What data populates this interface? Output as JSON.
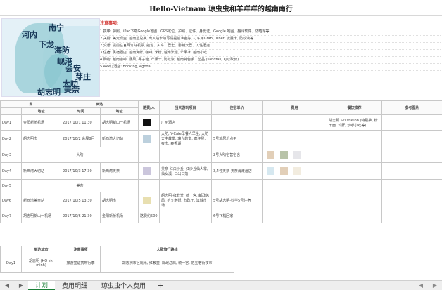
{
  "title": "Hello-Vietnam 琼虫虫和羊咩咩的越南南行",
  "map": {
    "cities": [
      "南宁",
      "河内",
      "下龙",
      "海防",
      "岘港",
      "会安",
      "芽庄",
      "大叻",
      "美奈",
      "胡志明"
    ]
  },
  "notes": {
    "heading": "注意事项:",
    "lines": [
      "1.携带: 护照、iPad下载Google地图、GPS定位、护照、证件、身份证、Google 地图、翻译软件、防晒霜等",
      "2.关键: 美元现金, 越南盾兑换, 出入境卡填写请提前准备好, 打车用Grab、Uber, 流量卡, 防蚊液等",
      "2.交通: 提前在官网订好机票, 航班、火车、巴士、卧铺大巴、入住酒店",
      "3.住宿: 民宿酒店, 越南海鲜, 咖啡, 米粉, 越南法棍, 芒果冰, 越南小吃",
      "4.购物: 越南咖啡, 腰果, 椰子糖, 芒果干, 防蚊液, 越南特色手工艺品 (sandfall, 可以砍价)",
      "5.APP订酒店: Booking, Agoda"
    ]
  },
  "table": {
    "headers": {
      "group_depart": "发",
      "group_arrive": "到达",
      "place": "地址",
      "time": "时间",
      "place2": "地址",
      "fee": "路费/人",
      "activity": "当天游玩项目",
      "lodging": "住宿单价",
      "cost": "费用",
      "food": "餐饮推荐",
      "ref": "参考图片"
    },
    "rows": [
      {
        "day": "Day1",
        "from": "金阳新桥机场",
        "time": "2017/10/1 11:30",
        "to": "胡志明新山一机场",
        "activity": "广州酒店",
        "lodging": "",
        "food": "胡志明 Ski station (特别推, 粉干面, 鸡肝, 沙嗲小吃等)"
      },
      {
        "day": "Day2",
        "from": "胡志明市",
        "time": "2017/10/2 会展8月",
        "to": "新西湾大切站",
        "activity": "大叻, Y-Cafe早餐人早坐, 大叻天主教堂, 瑞光教堂, 疯狂屋, 夜市, 春香湖",
        "lodging": "5号旅居乐点平",
        "food": ""
      },
      {
        "day": "Day3",
        "from": "大叻",
        "time": "",
        "to": "",
        "activity": "",
        "lodging": "2号大叻宿营宿舍",
        "food": ""
      },
      {
        "day": "Day4",
        "from": "新西湾大切站",
        "time": "2017/10/3 17:30",
        "to": "新西湾美奈",
        "activity": "美奈-红白沙丘, 红沙丘仙人掌, 仙女溪, 日出日落",
        "lodging": "3,4号美奈-美奈海滩酒店",
        "food": ""
      },
      {
        "day": "Day5",
        "from": "美奈",
        "time": "",
        "to": "",
        "activity": "",
        "lodging": "",
        "food": ""
      },
      {
        "day": "Day6",
        "from": "新西湾美奈站",
        "time": "2017/10/5 13:30",
        "to": "胡志明市",
        "activity": "胡志明-红教堂, 统一宫, 邮政总局, 范五老街, 市政厅, 滨城市场",
        "lodging": "5号胡志明-科学5号住宿",
        "food": ""
      },
      {
        "day": "Day7",
        "from": "胡志明新山一机场",
        "time": "2017/10/6 21:30",
        "to": "金阳新桥机场",
        "activity": "",
        "lodging": "6号飞机回家",
        "food": ""
      }
    ],
    "fee_note": "路费约500"
  },
  "bottom": {
    "headers": {
      "city": "到达城市",
      "notes": "注意事项",
      "route": "大致旅行路线"
    },
    "row": {
      "day": "Day1",
      "city": "胡志明 (HO chi minh)",
      "notes": "旅游签证携带行李",
      "route": "胡志明市区观光, 红教堂, 邮政总局, 统一宫, 范五老街夜市"
    }
  },
  "tabs": {
    "items": [
      "计划",
      "费用明细",
      "琼虫虫个人费用"
    ],
    "active": 0,
    "add": "+"
  },
  "colors": {
    "accent_green": "#1a7f37",
    "warn_red": "#d0312d"
  }
}
